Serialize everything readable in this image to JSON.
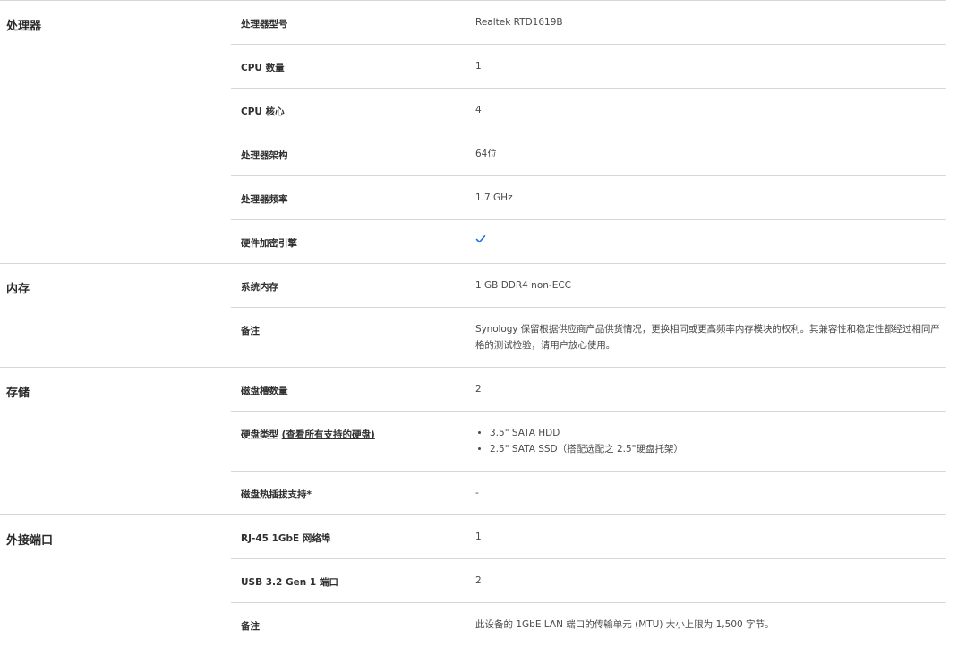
{
  "sections": [
    {
      "title": "处理器",
      "rows": [
        {
          "label": "处理器型号",
          "value": "Realtek RTD1619B"
        },
        {
          "label": "CPU 数量",
          "value": "1"
        },
        {
          "label": "CPU 核心",
          "value": "4"
        },
        {
          "label": "处理器架构",
          "value": "64位"
        },
        {
          "label": "处理器频率",
          "value": "1.7 GHz"
        },
        {
          "label": "硬件加密引擎",
          "value_icon": "checkmark-icon"
        }
      ]
    },
    {
      "title": "内存",
      "rows": [
        {
          "label": "系统内存",
          "value": "1 GB DDR4 non-ECC"
        },
        {
          "label": "备注",
          "value": "Synology 保留根据供应商产品供货情况，更换相同或更高频率内存模块的权利。其兼容性和稳定性都经过相同严格的测试检验，请用户放心使用。"
        }
      ]
    },
    {
      "title": "存储",
      "rows": [
        {
          "label": "磁盘槽数量",
          "value": "2"
        },
        {
          "label": "硬盘类型",
          "link": "(查看所有支持的硬盘)",
          "list": [
            "3.5\" SATA HDD",
            "2.5\" SATA SSD（搭配选配之 2.5\"硬盘托架）"
          ]
        },
        {
          "label": "磁盘热插拔支持*",
          "value": "-"
        }
      ]
    },
    {
      "title": "外接端口",
      "rows": [
        {
          "label": "RJ-45 1GbE 网络埠",
          "value": "1"
        },
        {
          "label": "USB 3.2 Gen 1 端口",
          "value": "2"
        },
        {
          "label": "备注",
          "value": "此设备的 1GbE LAN 端口的传输单元 (MTU) 大小上限为 1,500 字节。"
        }
      ]
    }
  ],
  "colors": {
    "check": "#1a73e8",
    "divider": "#d8d8d8",
    "text": "#303030"
  }
}
